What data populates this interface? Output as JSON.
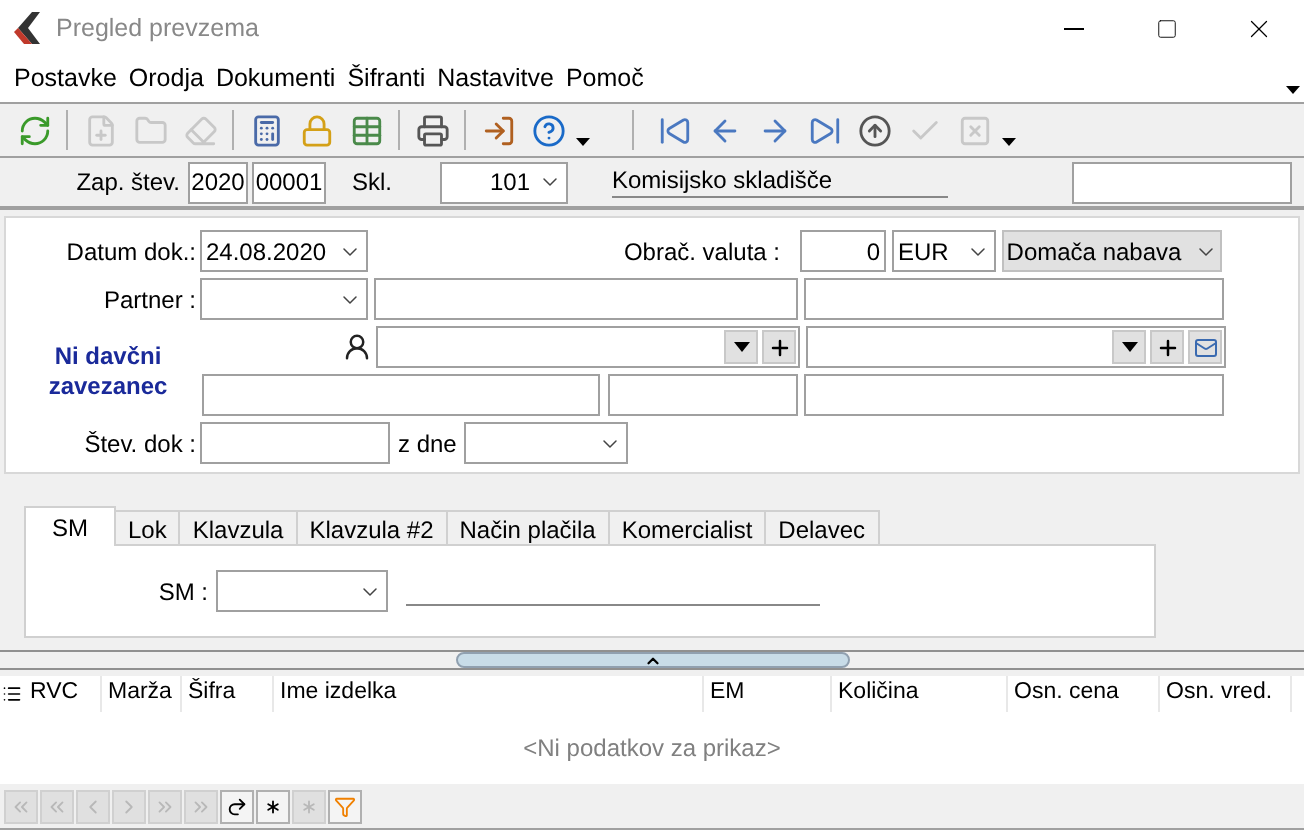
{
  "window": {
    "title": "Pregled prevzema"
  },
  "menu": [
    {
      "label": "Postavke"
    },
    {
      "label": "Orodja"
    },
    {
      "label": "Dokumenti"
    },
    {
      "label": "Šifranti"
    },
    {
      "label": "Nastavitve"
    },
    {
      "label": "Pomoč"
    }
  ],
  "toolbar": [
    {
      "kind": "refresh",
      "disabled": false
    },
    {
      "kind": "sep"
    },
    {
      "kind": "new",
      "disabled": true
    },
    {
      "kind": "open",
      "disabled": true
    },
    {
      "kind": "erase",
      "disabled": true
    },
    {
      "kind": "sep"
    },
    {
      "kind": "calculator",
      "disabled": false
    },
    {
      "kind": "lock",
      "disabled": false
    },
    {
      "kind": "table",
      "disabled": false
    },
    {
      "kind": "sep"
    },
    {
      "kind": "print",
      "disabled": false
    },
    {
      "kind": "sep"
    },
    {
      "kind": "exit",
      "disabled": false
    },
    {
      "kind": "help",
      "disabled": false
    },
    {
      "kind": "more"
    },
    {
      "kind": "bigsep"
    },
    {
      "kind": "first",
      "disabled": false
    },
    {
      "kind": "prev",
      "disabled": false
    },
    {
      "kind": "next",
      "disabled": false
    },
    {
      "kind": "last",
      "disabled": false
    },
    {
      "kind": "eject",
      "disabled": false
    },
    {
      "kind": "confirm",
      "disabled": true
    },
    {
      "kind": "cancel",
      "disabled": true
    },
    {
      "kind": "more"
    }
  ],
  "header": {
    "number_label": "Zap. štev.",
    "year": "2020",
    "number": "00001",
    "warehouse_label": "Skl.",
    "warehouse": "101",
    "warehouse_name": "Komisijsko skladišče"
  },
  "form": {
    "date_label": "Datum dok.:",
    "date": "24.08.2020",
    "currency_label": "Obrač. valuta :",
    "rate": "0",
    "currency": "EUR",
    "procurement": "Domača nabava",
    "partner_label": "Partner :",
    "tax_status": "Ni davčni zavezanec",
    "doc_number_label": "Štev. dok :",
    "date_from_label": "z dne"
  },
  "tabs": [
    {
      "label": "SM",
      "selected": true
    },
    {
      "label": "Lok",
      "selected": false
    },
    {
      "label": "Klavzula",
      "selected": false
    },
    {
      "label": "Klavzula #2",
      "selected": false
    },
    {
      "label": "Način plačila",
      "selected": false
    },
    {
      "label": "Komercialist",
      "selected": false
    },
    {
      "label": "Delavec",
      "selected": false
    }
  ],
  "tab_content": {
    "sm_label": "SM :"
  },
  "table": {
    "columns": [
      "RVC",
      "Marža",
      "Šifra",
      "Ime izdelka",
      "EM",
      "Količina",
      "Osn. cena",
      "Osn. vred."
    ],
    "empty_message": "<Ni podatkov za prikaz>"
  },
  "navigator": [
    {
      "kind": "first",
      "disabled": true
    },
    {
      "kind": "prev-page",
      "disabled": true
    },
    {
      "kind": "prev",
      "disabled": true
    },
    {
      "kind": "next",
      "disabled": true
    },
    {
      "kind": "next-page",
      "disabled": true
    },
    {
      "kind": "last",
      "disabled": true
    },
    {
      "kind": "refresh",
      "disabled": false
    },
    {
      "kind": "new",
      "disabled": false
    },
    {
      "kind": "clear",
      "disabled": true
    },
    {
      "kind": "filter",
      "disabled": false
    }
  ]
}
